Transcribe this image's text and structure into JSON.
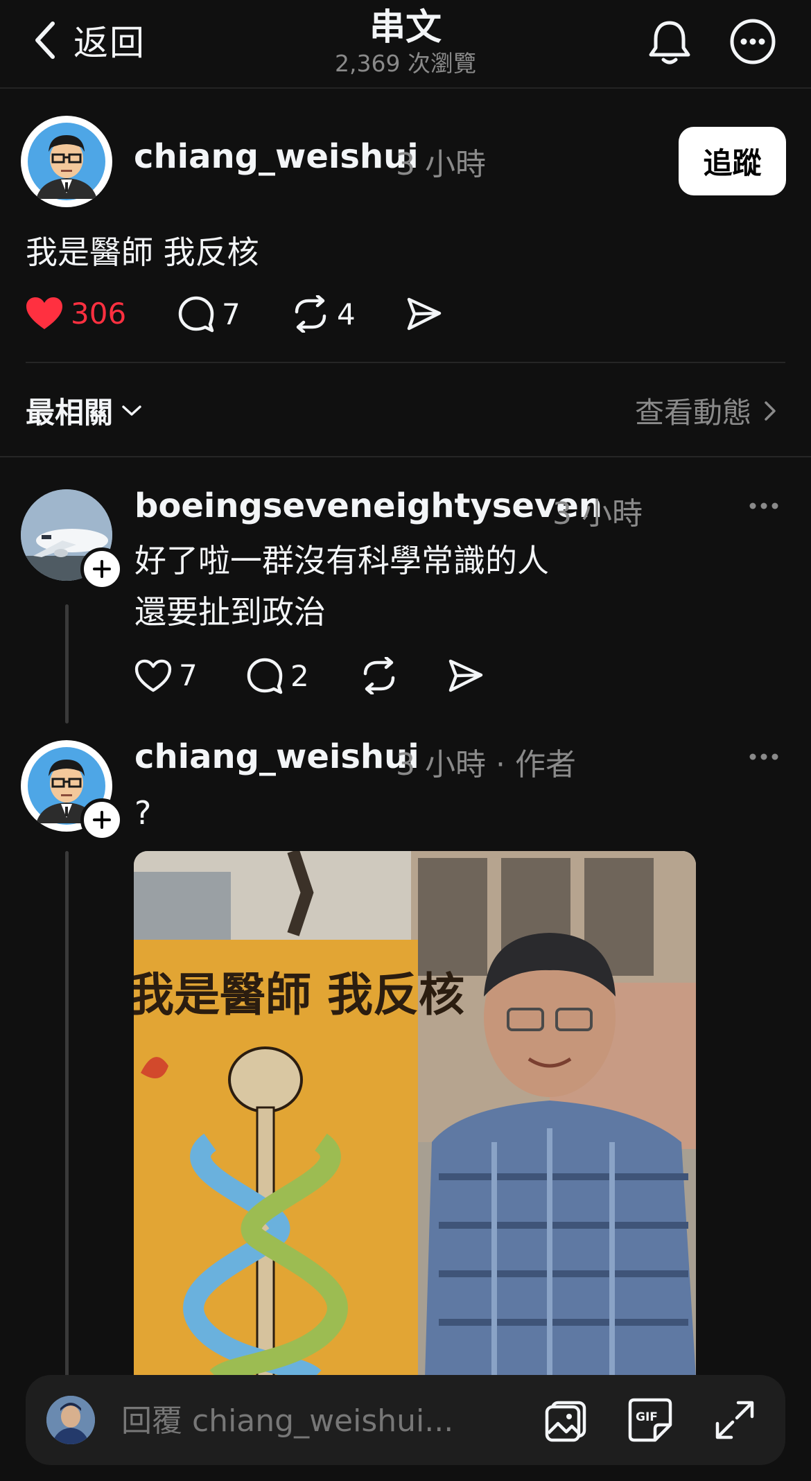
{
  "header": {
    "back_label": "返回",
    "title": "串文",
    "views": "2,369 次瀏覽"
  },
  "post": {
    "username": "chiang_weishui",
    "time": "3 小時",
    "follow_label": "追蹤",
    "text": "我是醫師 我反核",
    "likes": "306",
    "comments": "7",
    "reposts": "4",
    "liked": true
  },
  "sort": {
    "label": "最相關",
    "activity_label": "查看動態"
  },
  "replies": [
    {
      "username": "boeingseveneightyseven",
      "time": "3 小時",
      "lines": [
        "好了啦一群沒有科學常識的人",
        "還要扯到政治"
      ],
      "likes": "7",
      "comments": "2"
    },
    {
      "username": "chiang_weishui",
      "time": "3 小時",
      "author_tag": "作者",
      "text": "?",
      "image_sign_text": "我是醫師 我反核"
    }
  ],
  "composer": {
    "placeholder": "回覆 chiang_weishui..."
  },
  "colors": {
    "background": "#101010",
    "like_red": "#ff3040",
    "muted": "#8a8a8a"
  },
  "icons": [
    "chevron-left-icon",
    "bell-icon",
    "more-circle-icon",
    "heart-icon",
    "comment-icon",
    "repost-icon",
    "share-icon",
    "chevron-down-icon",
    "chevron-right-icon",
    "more-dots-icon",
    "plus-icon",
    "image-icon",
    "gif-icon",
    "expand-icon"
  ]
}
